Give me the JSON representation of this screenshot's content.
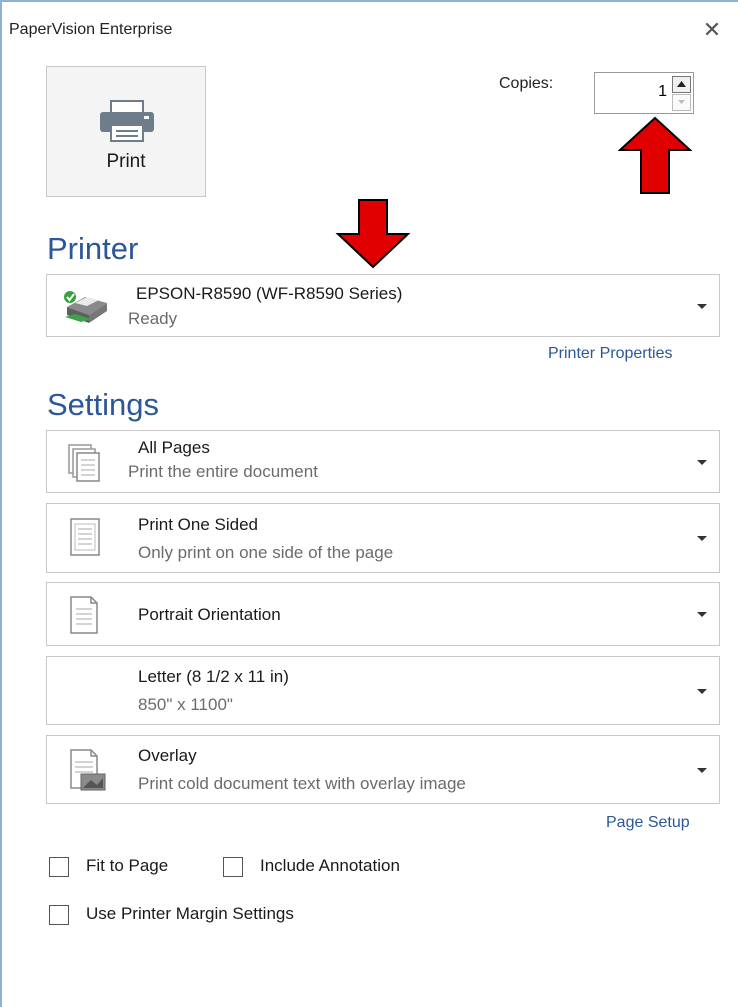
{
  "window": {
    "title": "PaperVision Enterprise"
  },
  "print_button": {
    "label": "Print"
  },
  "copies": {
    "label": "Copies:",
    "value": "1"
  },
  "printer": {
    "heading": "Printer",
    "selected_name": "EPSON-R8590 (WF-R8590 Series)",
    "status": "Ready",
    "properties_link": "Printer Properties"
  },
  "settings": {
    "heading": "Settings",
    "pages": {
      "title": "All Pages",
      "subtitle": "Print the entire document"
    },
    "sides": {
      "title": "Print One Sided",
      "subtitle": "Only print on one side of the page"
    },
    "orientation": {
      "title": "Portrait Orientation"
    },
    "paper": {
      "title": "Letter (8 1/2 x 11 in)",
      "subtitle": "850\" x 1100\""
    },
    "overlay": {
      "title": "Overlay",
      "subtitle": "Print cold document text with overlay image"
    },
    "page_setup_link": "Page Setup"
  },
  "options": {
    "fit_to_page": {
      "label": "Fit to Page",
      "checked": false
    },
    "include_annotation": {
      "label": "Include Annotation",
      "checked": false
    },
    "use_printer_margins": {
      "label": "Use Printer Margin Settings",
      "checked": false
    }
  },
  "annotation_arrows": {
    "color": "#e00000"
  },
  "colors": {
    "accent": "#2b5797",
    "border": "#c8c8c8"
  }
}
